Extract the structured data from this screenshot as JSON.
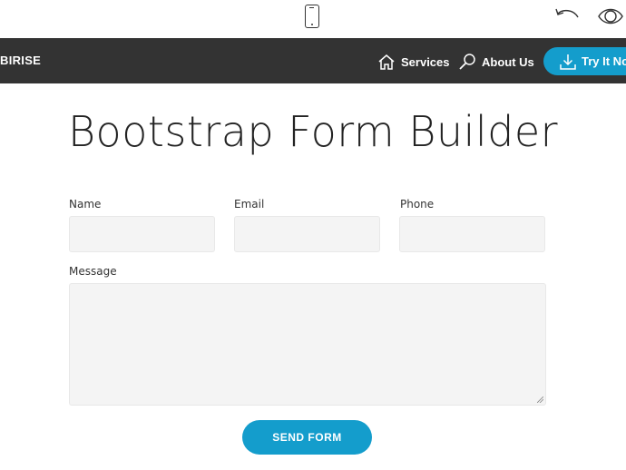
{
  "toolbar": {
    "icons": [
      "mobile-view-icon",
      "undo-icon",
      "preview-eye-icon"
    ]
  },
  "navbar": {
    "brand": "BIRISE",
    "services_label": "Services",
    "about_label": "About Us",
    "try_label": "Try It Now",
    "background": "#333333",
    "accent": "#149dcc"
  },
  "page": {
    "title": "Bootstrap Form Builder"
  },
  "form": {
    "name_label": "Name",
    "email_label": "Email",
    "phone_label": "Phone",
    "message_label": "Message",
    "name_value": "",
    "email_value": "",
    "phone_value": "",
    "message_value": "",
    "submit_label": "SEND FORM"
  }
}
